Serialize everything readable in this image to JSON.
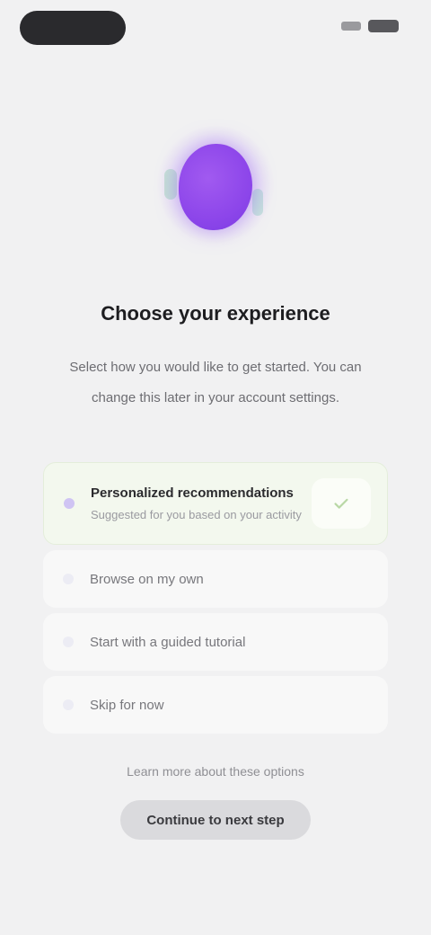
{
  "status_bar": {
    "left_pill": "",
    "signal_icon": "signal-icon",
    "battery_icon": "battery-icon"
  },
  "hero": {
    "icon": "purple-orb-icon",
    "accent": "#8d46ea"
  },
  "title": "Choose your experience",
  "description": "Select how you would like to get started. You can change this later in your account settings.",
  "options": [
    {
      "label": "Personalized recommendations",
      "sub": "Suggested for you based on your activity",
      "selected": true
    },
    {
      "label": "Browse on my own",
      "sub": "",
      "selected": false
    },
    {
      "label": "Start with a guided tutorial",
      "sub": "",
      "selected": false
    },
    {
      "label": "Skip for now",
      "sub": "",
      "selected": false
    }
  ],
  "secondary_link": "Learn more about these options",
  "primary_button": "Continue to next step",
  "colors": {
    "background": "#f1f1f2",
    "selected_option": "#f3f8ee",
    "check": "#7fbf5a"
  }
}
